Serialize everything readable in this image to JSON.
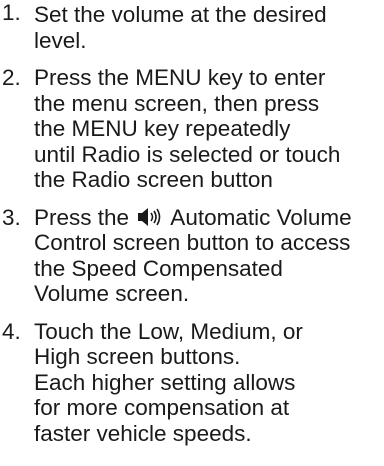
{
  "steps": [
    {
      "number": "1.",
      "lines": [
        "Set the volume at the desired",
        "level."
      ]
    },
    {
      "number": "2.",
      "lines": [
        "Press the MENU key to enter",
        "the menu screen, then press",
        "the MENU key repeatedly",
        "until Radio is selected or touch",
        "the Radio screen button"
      ]
    },
    {
      "number": "3.",
      "first_line_before_icon": "Press the",
      "first_line_after_icon": "Automatic Volume",
      "icon": "speaker-volume-icon",
      "lines": [
        "Control screen button to access",
        "the Speed Compensated",
        "Volume screen."
      ]
    },
    {
      "number": "4.",
      "lines": [
        "Touch the Low, Medium, or",
        "High screen buttons.",
        "Each higher setting allows",
        "for more compensation at",
        "faster vehicle speeds."
      ]
    }
  ]
}
